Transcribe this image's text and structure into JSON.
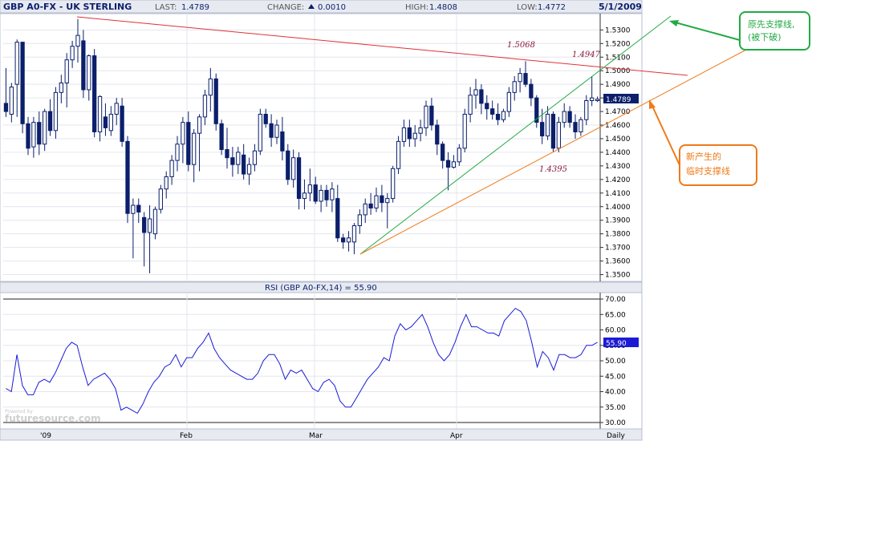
{
  "header": {
    "symbol": "GBP A0-FX - UK STERLING",
    "last_label": "LAST:",
    "last_value": "1.4789",
    "change_label": "CHANGE:",
    "change_value": "0.0010",
    "change_direction": "up",
    "high_label": "HIGH:",
    "high_value": "1.4808",
    "low_label": "LOW:",
    "low_value": "1.4772",
    "date": "5/1/2009"
  },
  "rsi_label": "RSI (GBP A0-FX,14) = 55.90",
  "rsi_current": "55.90",
  "last_price_tag": "1.4789",
  "watermark": {
    "small": "Powered by",
    "brand": "futuresource.com"
  },
  "period_label": "Daily",
  "callouts": [
    {
      "text": "原先支撑线,",
      "text2": "(被下破)",
      "color": "#22aa44"
    },
    {
      "text": "新产生的",
      "text2": "临时支撑线",
      "color": "#ee7a1a"
    }
  ],
  "annotations": [
    "1.5068",
    "1.4947",
    "1.4395"
  ],
  "chart_data": {
    "type": "candlestick",
    "price_axis": {
      "ylim": [
        1.345,
        1.542
      ],
      "ticks": [
        "1.5300",
        "1.5200",
        "1.5100",
        "1.5000",
        "1.4900",
        "1.4800",
        "1.4700",
        "1.4600",
        "1.4500",
        "1.4400",
        "1.4300",
        "1.4200",
        "1.4100",
        "1.4000",
        "1.3900",
        "1.3800",
        "1.3700",
        "1.3600",
        "1.3500"
      ]
    },
    "rsi_axis": {
      "ylim": [
        30,
        70
      ],
      "ticks": [
        "70.00",
        "65.00",
        "60.00",
        "55.00",
        "50.00",
        "45.00",
        "40.00",
        "35.00",
        "30.00"
      ]
    },
    "x_labels": [
      "'09",
      "Feb",
      "Mar",
      "Apr"
    ],
    "candles": [
      {
        "o": 1.476,
        "h": 1.502,
        "l": 1.466,
        "c": 1.47
      },
      {
        "o": 1.468,
        "h": 1.491,
        "l": 1.462,
        "c": 1.488
      },
      {
        "o": 1.49,
        "h": 1.523,
        "l": 1.466,
        "c": 1.521
      },
      {
        "o": 1.521,
        "h": 1.521,
        "l": 1.454,
        "c": 1.461
      },
      {
        "o": 1.461,
        "h": 1.466,
        "l": 1.438,
        "c": 1.443
      },
      {
        "o": 1.444,
        "h": 1.466,
        "l": 1.436,
        "c": 1.462
      },
      {
        "o": 1.462,
        "h": 1.47,
        "l": 1.438,
        "c": 1.446
      },
      {
        "o": 1.446,
        "h": 1.472,
        "l": 1.441,
        "c": 1.47
      },
      {
        "o": 1.47,
        "h": 1.479,
        "l": 1.452,
        "c": 1.456
      },
      {
        "o": 1.456,
        "h": 1.488,
        "l": 1.45,
        "c": 1.484
      },
      {
        "o": 1.484,
        "h": 1.497,
        "l": 1.476,
        "c": 1.491
      },
      {
        "o": 1.491,
        "h": 1.513,
        "l": 1.473,
        "c": 1.508
      },
      {
        "o": 1.508,
        "h": 1.522,
        "l": 1.502,
        "c": 1.518
      },
      {
        "o": 1.518,
        "h": 1.538,
        "l": 1.506,
        "c": 1.526
      },
      {
        "o": 1.522,
        "h": 1.53,
        "l": 1.48,
        "c": 1.486
      },
      {
        "o": 1.486,
        "h": 1.512,
        "l": 1.478,
        "c": 1.511
      },
      {
        "o": 1.511,
        "h": 1.516,
        "l": 1.451,
        "c": 1.455
      },
      {
        "o": 1.455,
        "h": 1.482,
        "l": 1.448,
        "c": 1.481
      },
      {
        "o": 1.466,
        "h": 1.476,
        "l": 1.452,
        "c": 1.458
      },
      {
        "o": 1.456,
        "h": 1.474,
        "l": 1.452,
        "c": 1.468
      },
      {
        "o": 1.468,
        "h": 1.48,
        "l": 1.46,
        "c": 1.476
      },
      {
        "o": 1.474,
        "h": 1.48,
        "l": 1.444,
        "c": 1.448
      },
      {
        "o": 1.448,
        "h": 1.452,
        "l": 1.388,
        "c": 1.395
      },
      {
        "o": 1.395,
        "h": 1.406,
        "l": 1.362,
        "c": 1.401
      },
      {
        "o": 1.401,
        "h": 1.406,
        "l": 1.388,
        "c": 1.396
      },
      {
        "o": 1.392,
        "h": 1.396,
        "l": 1.356,
        "c": 1.381
      },
      {
        "o": 1.381,
        "h": 1.401,
        "l": 1.351,
        "c": 1.391
      },
      {
        "o": 1.38,
        "h": 1.4,
        "l": 1.376,
        "c": 1.398
      },
      {
        "o": 1.398,
        "h": 1.416,
        "l": 1.395,
        "c": 1.413
      },
      {
        "o": 1.413,
        "h": 1.426,
        "l": 1.406,
        "c": 1.422
      },
      {
        "o": 1.422,
        "h": 1.438,
        "l": 1.416,
        "c": 1.434
      },
      {
        "o": 1.434,
        "h": 1.452,
        "l": 1.426,
        "c": 1.446
      },
      {
        "o": 1.446,
        "h": 1.466,
        "l": 1.432,
        "c": 1.462
      },
      {
        "o": 1.462,
        "h": 1.47,
        "l": 1.426,
        "c": 1.431
      },
      {
        "o": 1.431,
        "h": 1.457,
        "l": 1.418,
        "c": 1.454
      },
      {
        "o": 1.454,
        "h": 1.468,
        "l": 1.426,
        "c": 1.466
      },
      {
        "o": 1.466,
        "h": 1.486,
        "l": 1.46,
        "c": 1.482
      },
      {
        "o": 1.482,
        "h": 1.502,
        "l": 1.47,
        "c": 1.494
      },
      {
        "o": 1.494,
        "h": 1.498,
        "l": 1.456,
        "c": 1.461
      },
      {
        "o": 1.461,
        "h": 1.464,
        "l": 1.438,
        "c": 1.442
      },
      {
        "o": 1.442,
        "h": 1.458,
        "l": 1.428,
        "c": 1.436
      },
      {
        "o": 1.436,
        "h": 1.444,
        "l": 1.422,
        "c": 1.431
      },
      {
        "o": 1.431,
        "h": 1.444,
        "l": 1.424,
        "c": 1.44
      },
      {
        "o": 1.438,
        "h": 1.446,
        "l": 1.42,
        "c": 1.424
      },
      {
        "o": 1.424,
        "h": 1.436,
        "l": 1.416,
        "c": 1.431
      },
      {
        "o": 1.431,
        "h": 1.446,
        "l": 1.426,
        "c": 1.441
      },
      {
        "o": 1.441,
        "h": 1.472,
        "l": 1.438,
        "c": 1.468
      },
      {
        "o": 1.468,
        "h": 1.472,
        "l": 1.458,
        "c": 1.461
      },
      {
        "o": 1.461,
        "h": 1.468,
        "l": 1.444,
        "c": 1.451
      },
      {
        "o": 1.451,
        "h": 1.464,
        "l": 1.446,
        "c": 1.46
      },
      {
        "o": 1.455,
        "h": 1.466,
        "l": 1.434,
        "c": 1.441
      },
      {
        "o": 1.441,
        "h": 1.446,
        "l": 1.416,
        "c": 1.42
      },
      {
        "o": 1.42,
        "h": 1.442,
        "l": 1.414,
        "c": 1.436
      },
      {
        "o": 1.436,
        "h": 1.44,
        "l": 1.398,
        "c": 1.406
      },
      {
        "o": 1.406,
        "h": 1.42,
        "l": 1.398,
        "c": 1.41
      },
      {
        "o": 1.41,
        "h": 1.428,
        "l": 1.404,
        "c": 1.416
      },
      {
        "o": 1.416,
        "h": 1.422,
        "l": 1.402,
        "c": 1.404
      },
      {
        "o": 1.404,
        "h": 1.416,
        "l": 1.396,
        "c": 1.412
      },
      {
        "o": 1.412,
        "h": 1.416,
        "l": 1.4,
        "c": 1.405
      },
      {
        "o": 1.405,
        "h": 1.418,
        "l": 1.396,
        "c": 1.413
      },
      {
        "o": 1.406,
        "h": 1.416,
        "l": 1.374,
        "c": 1.377
      },
      {
        "o": 1.377,
        "h": 1.38,
        "l": 1.369,
        "c": 1.374
      },
      {
        "o": 1.374,
        "h": 1.382,
        "l": 1.367,
        "c": 1.377
      },
      {
        "o": 1.374,
        "h": 1.388,
        "l": 1.365,
        "c": 1.386
      },
      {
        "o": 1.386,
        "h": 1.398,
        "l": 1.38,
        "c": 1.394
      },
      {
        "o": 1.394,
        "h": 1.406,
        "l": 1.388,
        "c": 1.402
      },
      {
        "o": 1.402,
        "h": 1.41,
        "l": 1.394,
        "c": 1.399
      },
      {
        "o": 1.399,
        "h": 1.414,
        "l": 1.396,
        "c": 1.408
      },
      {
        "o": 1.408,
        "h": 1.416,
        "l": 1.396,
        "c": 1.403
      },
      {
        "o": 1.403,
        "h": 1.41,
        "l": 1.384,
        "c": 1.406
      },
      {
        "o": 1.406,
        "h": 1.43,
        "l": 1.403,
        "c": 1.428
      },
      {
        "o": 1.428,
        "h": 1.452,
        "l": 1.424,
        "c": 1.448
      },
      {
        "o": 1.448,
        "h": 1.464,
        "l": 1.444,
        "c": 1.458
      },
      {
        "o": 1.458,
        "h": 1.464,
        "l": 1.444,
        "c": 1.45
      },
      {
        "o": 1.45,
        "h": 1.46,
        "l": 1.444,
        "c": 1.454
      },
      {
        "o": 1.454,
        "h": 1.464,
        "l": 1.448,
        "c": 1.458
      },
      {
        "o": 1.458,
        "h": 1.478,
        "l": 1.452,
        "c": 1.474
      },
      {
        "o": 1.474,
        "h": 1.48,
        "l": 1.456,
        "c": 1.46
      },
      {
        "o": 1.46,
        "h": 1.464,
        "l": 1.438,
        "c": 1.446
      },
      {
        "o": 1.446,
        "h": 1.448,
        "l": 1.428,
        "c": 1.434
      },
      {
        "o": 1.434,
        "h": 1.44,
        "l": 1.412,
        "c": 1.429
      },
      {
        "o": 1.429,
        "h": 1.438,
        "l": 1.428,
        "c": 1.433
      },
      {
        "o": 1.433,
        "h": 1.446,
        "l": 1.43,
        "c": 1.443
      },
      {
        "o": 1.443,
        "h": 1.472,
        "l": 1.44,
        "c": 1.468
      },
      {
        "o": 1.468,
        "h": 1.488,
        "l": 1.462,
        "c": 1.482
      },
      {
        "o": 1.482,
        "h": 1.494,
        "l": 1.472,
        "c": 1.486
      },
      {
        "o": 1.486,
        "h": 1.49,
        "l": 1.468,
        "c": 1.476
      },
      {
        "o": 1.476,
        "h": 1.482,
        "l": 1.464,
        "c": 1.472
      },
      {
        "o": 1.472,
        "h": 1.478,
        "l": 1.464,
        "c": 1.468
      },
      {
        "o": 1.468,
        "h": 1.476,
        "l": 1.46,
        "c": 1.464
      },
      {
        "o": 1.464,
        "h": 1.472,
        "l": 1.462,
        "c": 1.47
      },
      {
        "o": 1.47,
        "h": 1.488,
        "l": 1.466,
        "c": 1.484
      },
      {
        "o": 1.484,
        "h": 1.496,
        "l": 1.478,
        "c": 1.492
      },
      {
        "o": 1.492,
        "h": 1.502,
        "l": 1.484,
        "c": 1.498
      },
      {
        "o": 1.498,
        "h": 1.507,
        "l": 1.488,
        "c": 1.49
      },
      {
        "o": 1.49,
        "h": 1.494,
        "l": 1.474,
        "c": 1.48
      },
      {
        "o": 1.48,
        "h": 1.482,
        "l": 1.458,
        "c": 1.462
      },
      {
        "o": 1.462,
        "h": 1.472,
        "l": 1.446,
        "c": 1.452
      },
      {
        "o": 1.452,
        "h": 1.474,
        "l": 1.449,
        "c": 1.468
      },
      {
        "o": 1.468,
        "h": 1.47,
        "l": 1.44,
        "c": 1.443
      },
      {
        "o": 1.443,
        "h": 1.466,
        "l": 1.44,
        "c": 1.462
      },
      {
        "o": 1.462,
        "h": 1.476,
        "l": 1.458,
        "c": 1.47
      },
      {
        "o": 1.47,
        "h": 1.474,
        "l": 1.458,
        "c": 1.462
      },
      {
        "o": 1.462,
        "h": 1.468,
        "l": 1.45,
        "c": 1.455
      },
      {
        "o": 1.455,
        "h": 1.466,
        "l": 1.452,
        "c": 1.464
      },
      {
        "o": 1.464,
        "h": 1.482,
        "l": 1.46,
        "c": 1.478
      },
      {
        "o": 1.478,
        "h": 1.496,
        "l": 1.474,
        "c": 1.48
      },
      {
        "o": 1.478,
        "h": 1.481,
        "l": 1.477,
        "c": 1.479
      }
    ],
    "rsi": [
      41,
      40,
      52,
      42,
      39,
      39,
      43,
      44,
      43,
      46,
      50,
      54,
      56,
      55,
      48,
      42,
      44,
      45,
      46,
      44,
      41,
      34,
      35,
      34,
      33,
      36,
      40,
      43,
      45,
      48,
      49,
      52,
      48,
      51,
      51,
      54,
      56,
      59,
      54,
      51,
      49,
      47,
      46,
      45,
      44,
      44,
      46,
      50,
      52,
      52,
      49,
      44,
      47,
      46,
      47,
      44,
      41,
      40,
      43,
      44,
      42,
      37,
      35,
      35,
      38,
      41,
      44,
      46,
      48,
      51,
      50,
      58,
      62,
      60,
      61,
      63,
      65,
      61,
      56,
      52,
      50,
      52,
      56,
      61,
      65,
      61,
      61,
      60,
      59,
      59,
      58,
      63,
      65,
      67,
      66,
      63,
      56,
      48,
      53,
      51,
      47,
      52,
      52,
      51,
      51,
      52,
      55,
      55,
      56
    ]
  }
}
